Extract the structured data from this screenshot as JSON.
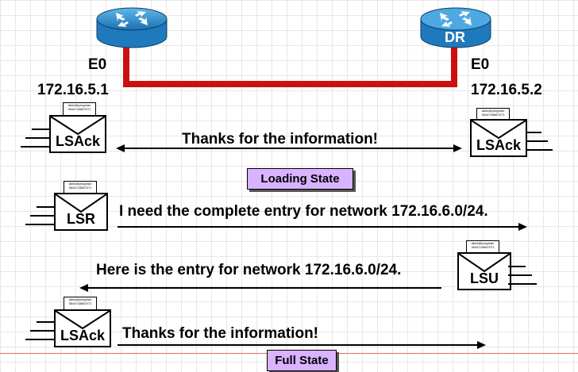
{
  "routers": {
    "left": {
      "interface": "E0",
      "ip": "172.16.5.1",
      "role": ""
    },
    "right": {
      "interface": "E0",
      "ip": "172.16.5.2",
      "role": "DR"
    }
  },
  "packets": {
    "lsack_left": {
      "label": "LSAck",
      "note_line1": "abed@progman",
      "note_line2": "3644743867071"
    },
    "lsack_right": {
      "label": "LSAck",
      "note_line1": "abed@progman",
      "note_line2": "3644743867071"
    },
    "lsr": {
      "label": "LSR",
      "note_line1": "abed@progman",
      "note_line2": "3644743867071"
    },
    "lsu": {
      "label": "LSU",
      "note_line1": "abed@progman",
      "note_line2": "3644743867071"
    },
    "lsack_bottom": {
      "label": "LSAck",
      "note_line1": "abed@progman",
      "note_line2": "3644743867071"
    }
  },
  "messages": {
    "thanks_1": "Thanks for the information!",
    "need_entry": "I need the complete entry for network 172.16.6.0/24.",
    "here_entry": "Here is the entry for network 172.16.6.0/24.",
    "thanks_2": "Thanks for the information!"
  },
  "states": {
    "loading": "Loading State",
    "full": "Full State"
  },
  "colors": {
    "link": "#cc1010",
    "router_blue": "#2a8fd0",
    "state_fill": "#d9b3ff"
  }
}
